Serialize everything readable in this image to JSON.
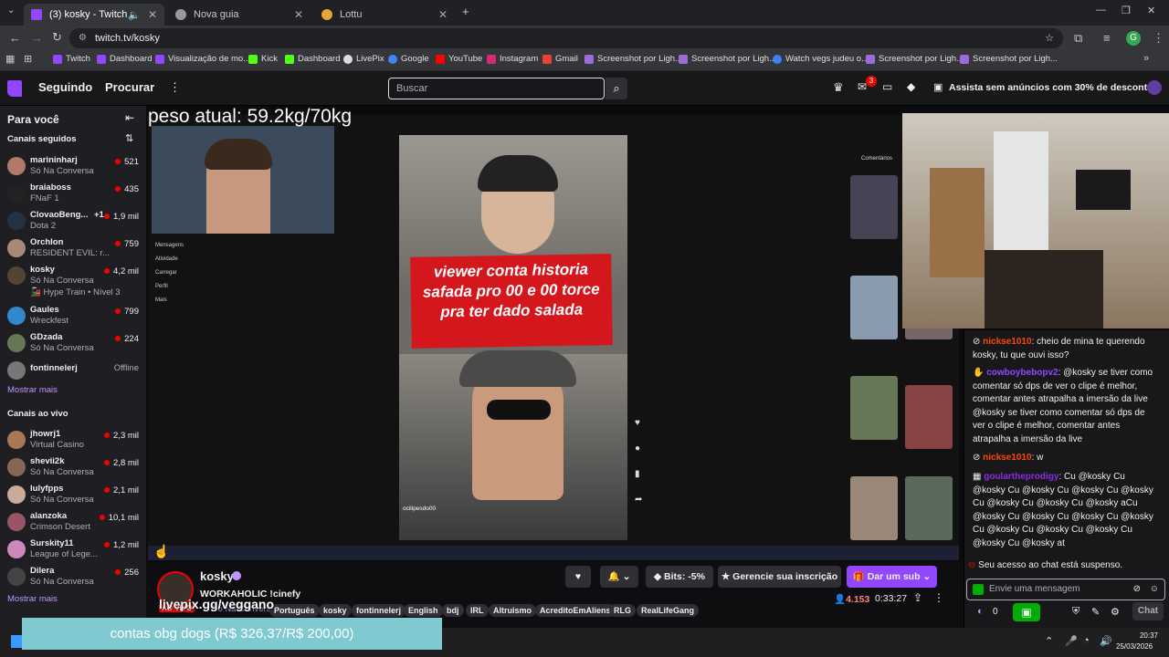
{
  "browser": {
    "tabs": [
      {
        "title": "(3) kosky - Twitch",
        "color": "#9146ff"
      },
      {
        "title": "Nova guia",
        "color": "#999999"
      },
      {
        "title": "Lottu",
        "color": "#e8a33b"
      }
    ],
    "url": "twitch.tv/kosky",
    "bookmarks": [
      "Twitch",
      "Dashboard",
      "Visualização de mo...",
      "Kick",
      "Dashboard",
      "LivePix",
      "Google",
      "YouTube",
      "Instagram",
      "Gmail",
      "Screenshot por Ligh...",
      "Screenshot por Ligh...",
      "Watch vegs judeu o...",
      "Screenshot por Ligh...",
      "Screenshot por Ligh..."
    ],
    "profile_initial": "G"
  },
  "nav": {
    "following": "Seguindo",
    "browse": "Procurar",
    "search_placeholder": "Buscar",
    "notifications_count": "3",
    "promo": "Assista sem anúncios com 30% de desconto"
  },
  "sidebar": {
    "for_you": "Para você",
    "followed_header": "Canais seguidos",
    "followed": [
      {
        "name": "marininharj",
        "game": "Só Na Conversa",
        "viewers": "521",
        "color": "#b07a6a"
      },
      {
        "name": "braiaboss",
        "game": "FNaF 1",
        "viewers": "435",
        "color": "#222222"
      },
      {
        "name": "ClovaoBeng...",
        "game": "Dota 2",
        "viewers": "1,9 mil",
        "extra": "+1",
        "color": "#223344"
      },
      {
        "name": "Orchlon",
        "game": "RESIDENT EVIL: r...",
        "viewers": "759",
        "color": "#aa8877"
      },
      {
        "name": "kosky",
        "game": "Só Na Conversa",
        "viewers": "4,2 mil",
        "hype": "Hype Train • Nível 3",
        "color": "#554433"
      },
      {
        "name": "Gaules",
        "game": "Wreckfest",
        "viewers": "799",
        "color": "#3388cc"
      },
      {
        "name": "GDzada",
        "game": "Só Na Conversa",
        "viewers": "224",
        "color": "#667755"
      },
      {
        "name": "fontinnelerj",
        "game": "",
        "viewers": "Offline",
        "color": "#777777"
      }
    ],
    "show_more": "Mostrar mais",
    "live_header": "Canais ao vivo",
    "live": [
      {
        "name": "jhowrj1",
        "game": "Virtual Casino",
        "viewers": "2,3 mil",
        "color": "#aa7755"
      },
      {
        "name": "shevii2k",
        "game": "Só Na Conversa",
        "viewers": "2,8 mil",
        "color": "#886655"
      },
      {
        "name": "lulyfpps",
        "game": "Só Na Conversa",
        "viewers": "2,1 mil",
        "color": "#ccaa99"
      },
      {
        "name": "alanzoka",
        "game": "Crimson Desert",
        "viewers": "10,1 mil",
        "color": "#995566"
      },
      {
        "name": "Surskity11",
        "game": "League of Lege...",
        "viewers": "1,2 mil",
        "color": "#cc88bb"
      },
      {
        "name": "Dilera",
        "game": "Só Na Conversa",
        "viewers": "256",
        "color": "#444444"
      }
    ],
    "show_more_live": "Mostrar mais"
  },
  "stream": {
    "overlay_weight": "peso atual: 59.2kg/70kg",
    "caption": "viewer conta historia safada pro 00 e 00 torce pra ter dado salada",
    "tiktok_menu": [
      "Mensagens",
      "Atividade",
      "Carregar",
      "Perfil",
      "Mais"
    ],
    "tiktok_comments": "Comentários",
    "tiktok_author": "ocilipesdo00",
    "livepix": "livepix.gg/veggano",
    "donation": "contas obg dogs (R$ 326,37/R$ 200,00)"
  },
  "channel": {
    "name": "kosky",
    "title": "WORKAHOLIC !cinefy",
    "category": "Só Na Conversa",
    "bits_label": "Bits: -5%",
    "manage_sub": "Gerencie sua inscrição",
    "gift_sub": "Dar um sub",
    "viewers": "4.153",
    "uptime": "0:33:27",
    "tags": [
      "Português",
      "kosky",
      "fontinnelerj",
      "English",
      "bdj",
      "IRL",
      "Altruismo",
      "AcreditoEmAliens",
      "RLG",
      "RealLifeGang"
    ]
  },
  "chat": {
    "messages": [
      {
        "user": "nickse1010",
        "color": "#ff4500",
        "text": ": cheio de mina te querendo kosky, tu que ouvi isso?"
      },
      {
        "user": "cowboybebopv2",
        "color": "#9146ff",
        "text": ": @kosky se tiver como comentar só dps de ver o clipe é melhor, comentar antes atrapalha a imersão da live @kosky se tiver como comentar só dps de ver o clipe é melhor, comentar antes atrapalha a imersão da live"
      },
      {
        "user": "nickse1010",
        "color": "#ff4500",
        "text": ": w"
      },
      {
        "user": "goulartheprodigy",
        "color": "#8a2be2",
        "text": ": Cu @kosky Cu @kosky Cu @kosky Cu @kosky Cu @kosky Cu @kosky Cu @kosky Cu @kosky aCu @kosky Cu @kosky Cu @kosky Cu @kosky Cu @kosky Cu @kosky Cu @kosky Cu @kosky Cu @kosky at"
      }
    ],
    "suspended": "Seu acesso ao chat está suspenso.",
    "input_placeholder": "Envie uma mensagem",
    "points": "0",
    "chat_button": "Chat"
  },
  "taskbar": {
    "time": "20:37",
    "date": "25/03/2026"
  }
}
